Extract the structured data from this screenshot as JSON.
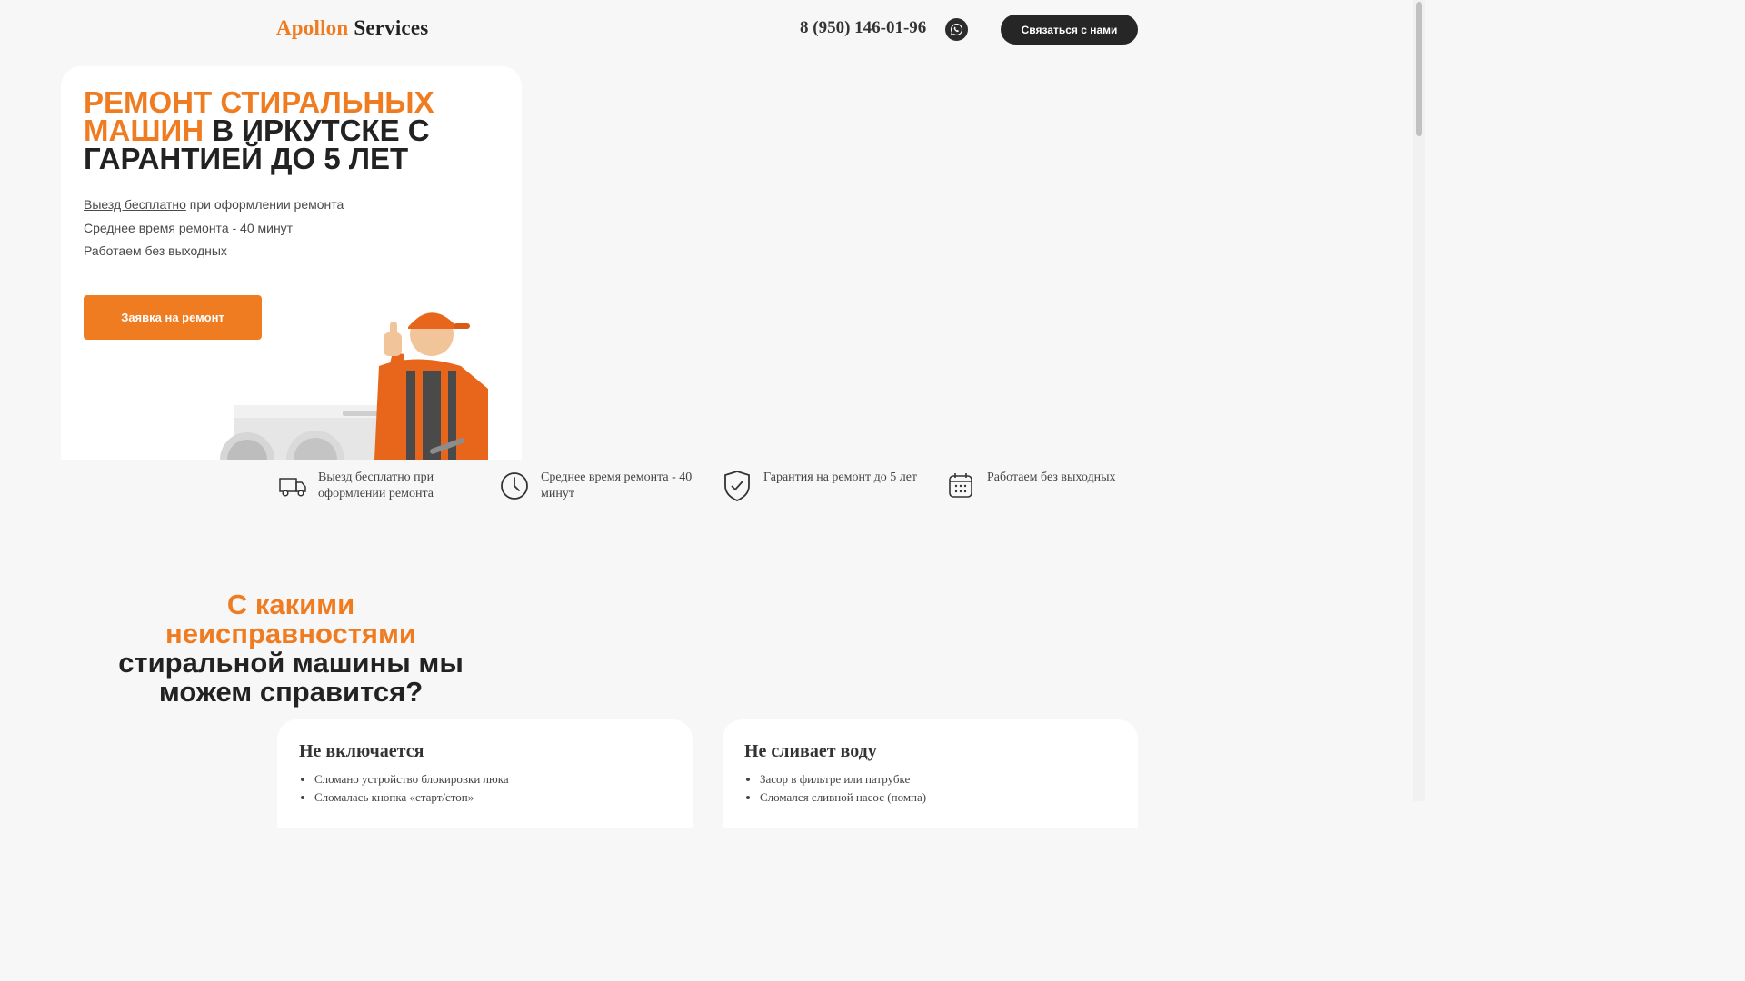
{
  "header": {
    "logo_part1": "Apollon",
    "logo_part2": "Services",
    "phone": "8 (950) 146-01-96",
    "whatsapp_icon": "whatsapp-icon",
    "contact_button": "Связаться с нами"
  },
  "hero": {
    "title_highlight": "Ремонт стиральных машин",
    "title_rest": "в Иркутске с гарантией до 5 лет",
    "bullet1_underlined": "Выезд бесплатно",
    "bullet1_rest": " при оформлении ремонта",
    "bullet2": "Среднее время ремонта - 40 минут",
    "bullet3": "Работаем без выходных",
    "order_button": "Заявка на ремонт"
  },
  "features": [
    {
      "icon": "truck-icon",
      "text": "Выезд бесплатно при оформлении ремонта"
    },
    {
      "icon": "clock-icon",
      "text": "Среднее время ремонта - 40 минут"
    },
    {
      "icon": "shield-check-icon",
      "text": "Гарантия на ремонт до 5 лет"
    },
    {
      "icon": "calendar-icon",
      "text": "Работаем без выходных"
    }
  ],
  "faults_section": {
    "title_highlight": "С какими неисправностями",
    "title_rest": "стиральной машины мы можем справится?"
  },
  "fault_cards": [
    {
      "title": "Не включается",
      "items": [
        "Сломано устройство блокировки люка",
        "Сломалась кнопка «старт/стоп»"
      ]
    },
    {
      "title": "Не сливает воду",
      "items": [
        "Засор в фильтре или патрубке",
        "Сломался сливной насос (помпа)"
      ]
    }
  ],
  "colors": {
    "accent": "#f07c22",
    "dark": "#262626",
    "background": "#f7f7f7"
  }
}
